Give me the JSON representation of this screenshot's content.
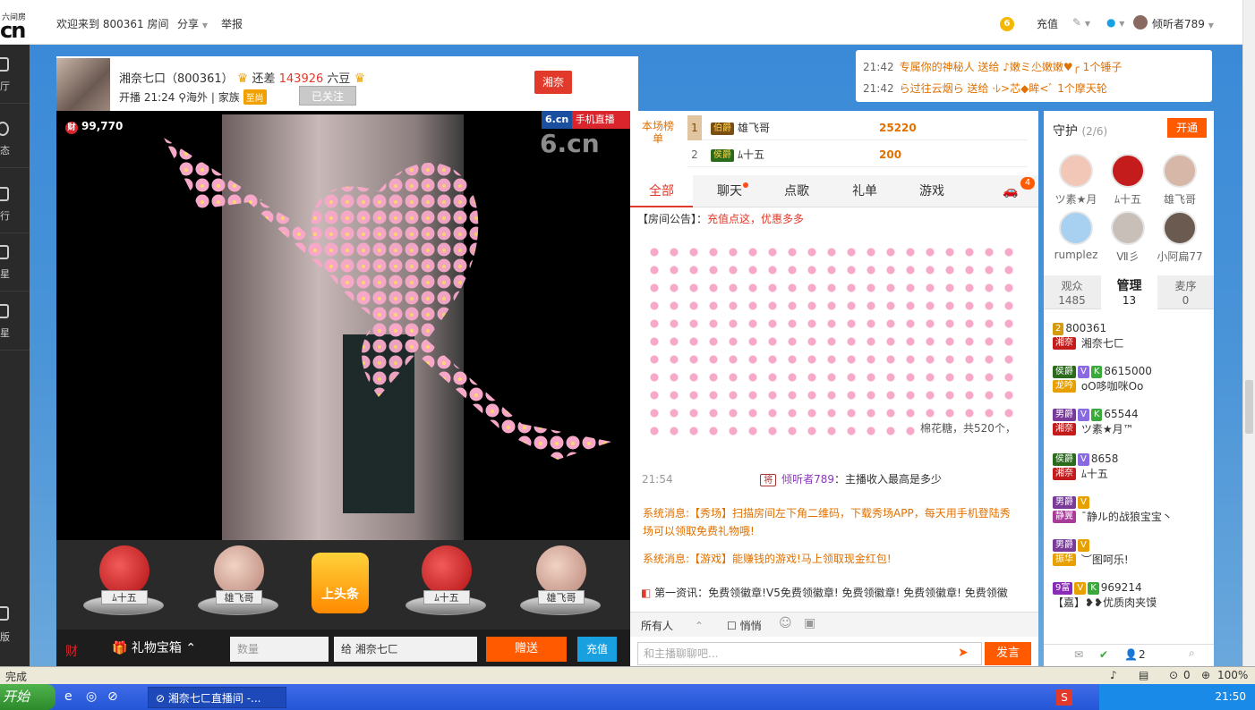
{
  "topbar": {
    "logo_small": "六间房",
    "logo_big": "cn",
    "welcome": "欢迎来到 800361 房间",
    "share": "分享",
    "report": "举报",
    "coin_level": "6",
    "charge": "充值",
    "username": "倾听者789"
  },
  "leftnav": [
    "厅",
    "态",
    "行",
    "星",
    "星",
    "版"
  ],
  "header": {
    "name": "湘奈七口（800361）",
    "need_label": "还差",
    "need_value": "143926",
    "need_unit": "六豆",
    "start_time": "开播 21:24",
    "location": "海外",
    "family_label": "家族",
    "family_tag": "至尚",
    "follow": "已关注",
    "flag": "湘奈"
  },
  "gift_notices": [
    {
      "time": "21:42",
      "text": "专属你的神秘人 送给 ♪嫩ミ尐嫩嫩♥╭ 1个锤子"
    },
    {
      "time": "21:42",
      "text": "ら过往云烟ら 送给 ·ﾚ>芯◆眸<ﾞ 1个摩天轮"
    }
  ],
  "video": {
    "fortune": "99,770",
    "fortune_icon": "财",
    "brand": "6.cn",
    "mobile_live": "手机直播",
    "watermark": "6.cn"
  },
  "podium": [
    {
      "name": "ﾑ十五",
      "type": "red"
    },
    {
      "name": "雄飞哥",
      "type": "face"
    },
    {
      "name": "上头条",
      "type": "headline"
    },
    {
      "name": "ﾑ十五",
      "type": "red"
    },
    {
      "name": "雄飞哥",
      "type": "face"
    }
  ],
  "giftbar": {
    "icon": "财",
    "treasure": "礼物宝箱",
    "qty_placeholder": "数量",
    "to_label": "给",
    "to_name": "湘奈七ㄈ",
    "send": "赠送",
    "charge": "充值"
  },
  "rank": {
    "tag": "本场榜单",
    "rows": [
      {
        "n": "1",
        "badge": "伯爵",
        "name": "雄飞哥",
        "amount": "25220"
      },
      {
        "n": "2",
        "badge": "侯爵",
        "name": "ﾑ十五",
        "amount": "200"
      }
    ]
  },
  "tabs": [
    "全部",
    "聊天",
    "点歌",
    "礼单",
    "游戏"
  ],
  "car_count": "4",
  "notice": {
    "label": "【房间公告】：",
    "text": "充值点这，优惠多多"
  },
  "cotton_text": "棉花糖，共520个，",
  "chat_msg": {
    "time": "21:54",
    "badge": "将",
    "name": "倾听者789",
    "text": "：主播收入最高是多少"
  },
  "system_msgs": [
    "系统消息:【秀场】扫描房间左下角二维码，下载秀场APP，每天用手机登陆秀场可以领取免费礼物哦!",
    "系统消息:【游戏】能赚钱的游戏!马上领取现金红包!"
  ],
  "first_news": "第一资讯：免费领徽章!V5免费领徽章! 免费领徽章! 免费领徽章! 免费领徽",
  "chatctl": {
    "target": "所有人",
    "whisper": "悄悄"
  },
  "chat_placeholder": "和主播聊聊吧...",
  "speak": "发言",
  "guard": {
    "title": "守护",
    "count": "(2/6)",
    "open": "开通",
    "members": [
      "ツ素★月",
      "ﾑ十五",
      "雄飞哥",
      "rumplez",
      "Ⅶ彡",
      "小阿扁77"
    ]
  },
  "rtabs": [
    {
      "label": "观众",
      "count": "1485"
    },
    {
      "label": "管理",
      "count": "13"
    },
    {
      "label": "麦序",
      "count": "0"
    }
  ],
  "users": [
    {
      "top": "800361",
      "bottom": "湘奈七ㄈ"
    },
    {
      "top": "8615000",
      "bottom": "oO哆咖咪Oo"
    },
    {
      "top": "65544",
      "bottom": "ツ素★月™"
    },
    {
      "top": "8658",
      "bottom": "ﾑ十五"
    },
    {
      "top": "",
      "bottom": "ˉ静ル的战狼宝宝丶"
    },
    {
      "top": "",
      "bottom": "︶图呵乐!"
    },
    {
      "top": "969214",
      "bottom": "【嘉】❥❥优质肉夹馍"
    }
  ],
  "right_bottom": {
    "count": "2"
  },
  "status": {
    "left": "完成",
    "zoom": "100%",
    "count": "0"
  },
  "taskbar": {
    "start": "开始",
    "window": "湘奈七ㄈ直播间 -...",
    "time": "21:50"
  }
}
